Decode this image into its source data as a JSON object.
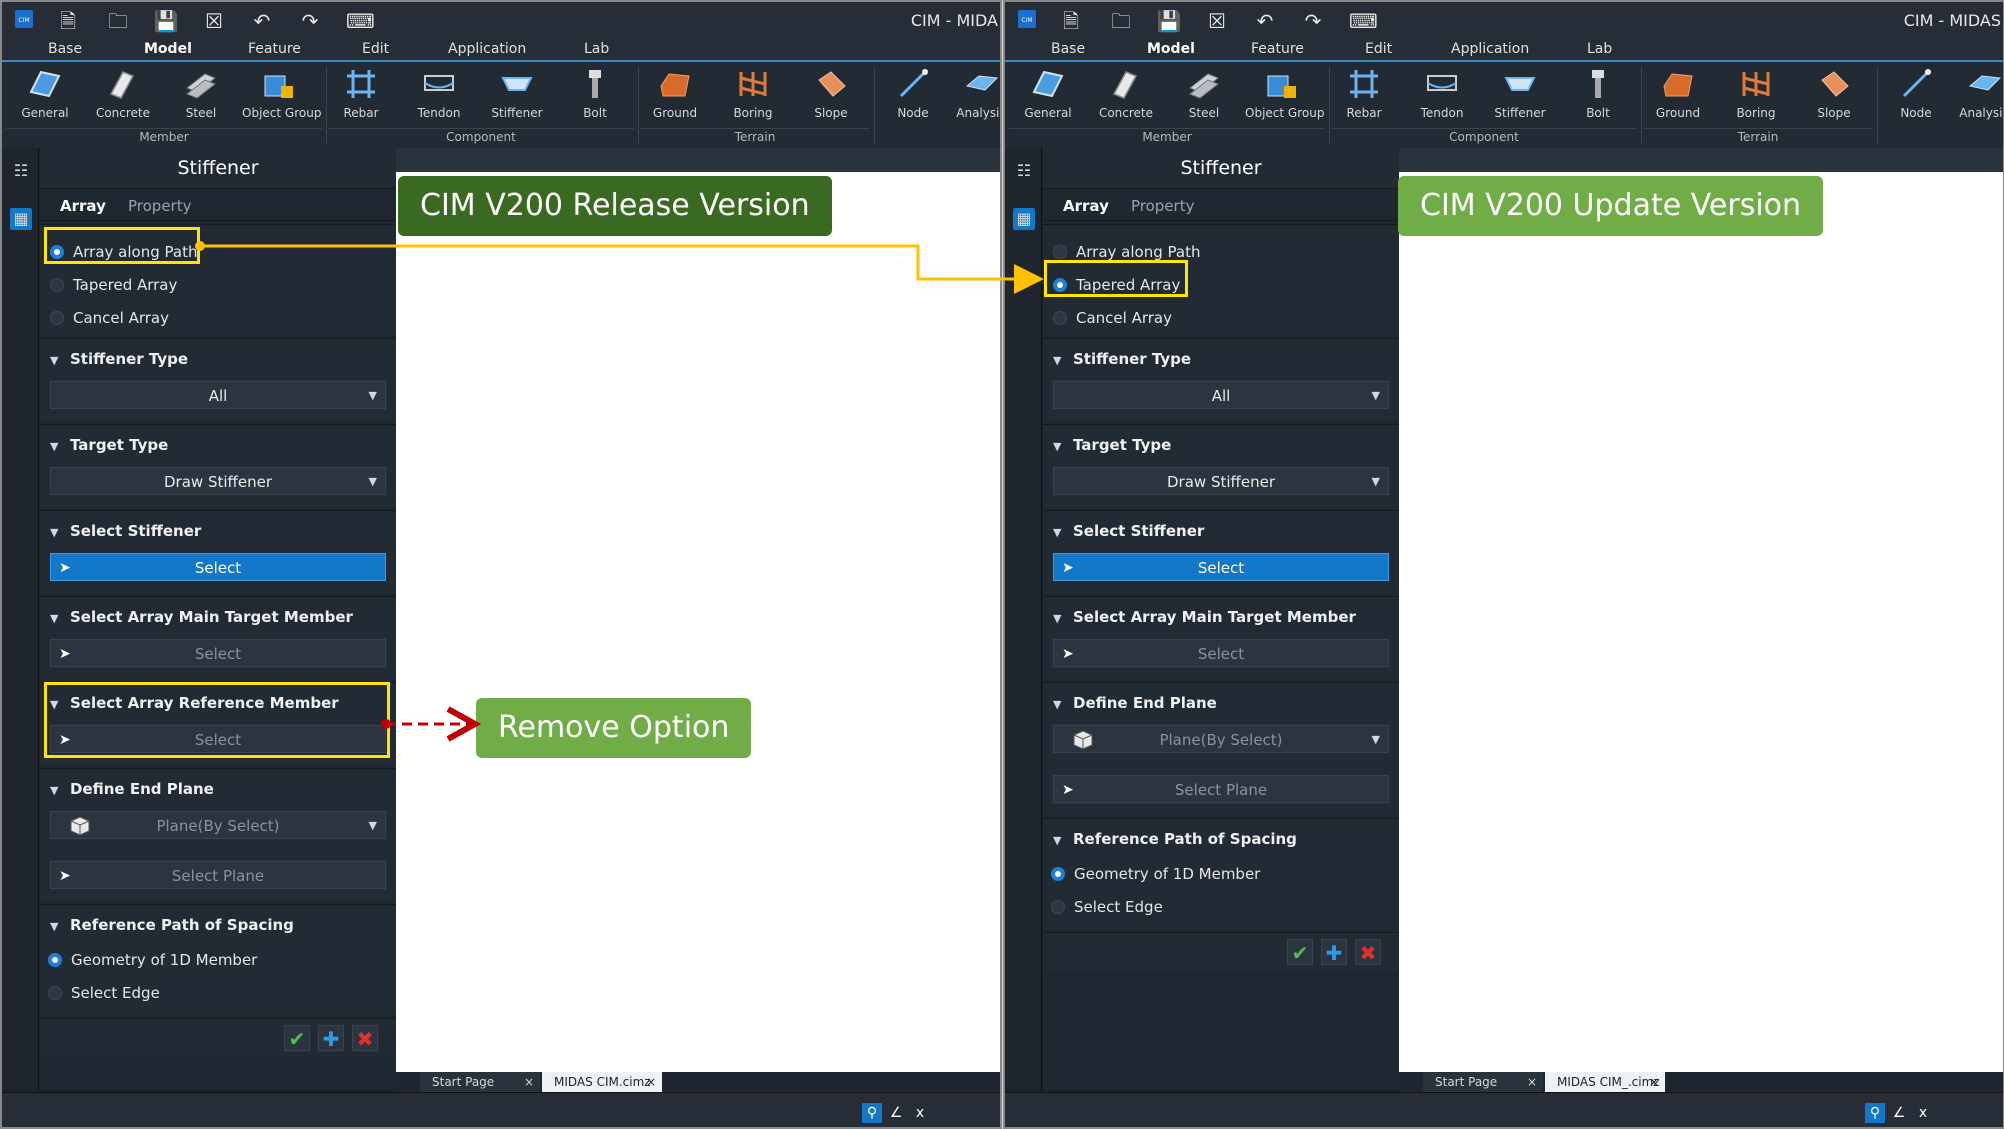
{
  "window": {
    "title": "CIM - MIDA",
    "title_right": "CIM - MIDAS"
  },
  "menus": [
    "Base",
    "Model",
    "Feature",
    "Edit",
    "Application",
    "Lab"
  ],
  "active_menu": "Model",
  "ribbon": {
    "buttons": [
      "General",
      "Concrete",
      "Steel",
      "Object Group",
      "Rebar",
      "Tendon",
      "Stiffener",
      "Bolt",
      "Ground",
      "Boring",
      "Slope",
      "Node",
      "Analysis"
    ],
    "groups": [
      "Member",
      "Component",
      "Terrain"
    ]
  },
  "panel": {
    "title": "Stiffener",
    "tabs": [
      "Array",
      "Property"
    ],
    "array_options": [
      "Array along Path",
      "Tapered Array",
      "Cancel Array"
    ],
    "stiffener_type": {
      "label": "Stiffener Type",
      "value": "All"
    },
    "target_type": {
      "label": "Target Type",
      "value": "Draw Stiffener"
    },
    "select_stiffener": {
      "label": "Select Stiffener",
      "button": "Select"
    },
    "select_main_member": {
      "label": "Select Array Main Target Member",
      "button": "Select"
    },
    "select_ref_member": {
      "label": "Select Array Reference Member",
      "button": "Select"
    },
    "end_plane": {
      "label": "Define End Plane",
      "value": "Plane(By Select)",
      "button": "Select Plane"
    },
    "ref_path": {
      "label": "Reference Path of Spacing",
      "options": [
        "Geometry of 1D Member",
        "Select Edge"
      ]
    }
  },
  "doc_tabs": {
    "left": [
      "Start Page",
      "MIDAS CIM.cimz"
    ],
    "right": [
      "Start Page",
      "MIDAS CIM_.cimz"
    ]
  },
  "annotations": {
    "release": "CIM V200 Release Version",
    "update": "CIM V200 Update Version",
    "remove": "Remove Option"
  },
  "colors": {
    "accent": "#1577c8",
    "highlight": "#ffe600",
    "label_green": "#70ad47",
    "label_dark": "#3a6a22",
    "arrow_red": "#c00000"
  }
}
